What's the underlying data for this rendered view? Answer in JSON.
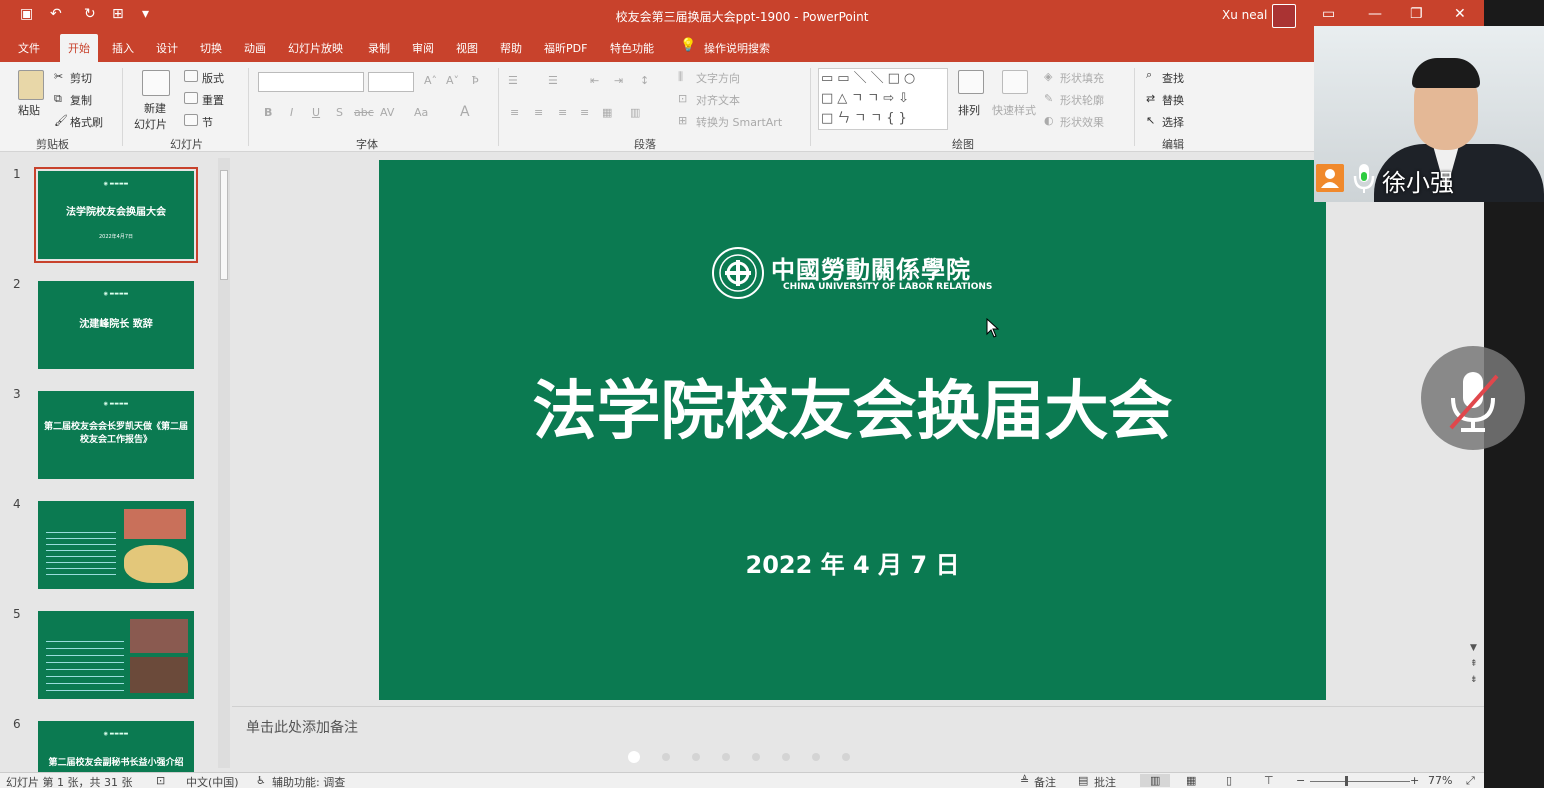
{
  "window": {
    "title": "校友会第三届换届大会ppt-1900 - PowerPoint",
    "user": "Xu neal"
  },
  "tabs": [
    "文件",
    "开始",
    "插入",
    "设计",
    "切换",
    "动画",
    "幻灯片放映",
    "录制",
    "审阅",
    "视图",
    "帮助",
    "福昕PDF",
    "特色功能",
    "操作说明搜索"
  ],
  "ribbon": {
    "clipboard": {
      "paste": "粘贴",
      "cut": "剪切",
      "copy": "复制",
      "format_painter": "格式刷",
      "label": "剪贴板"
    },
    "slides": {
      "new_slide": "新建",
      "new_slide2": "幻灯片",
      "layout": "版式",
      "reset": "重置",
      "section": "节",
      "label": "幻灯片"
    },
    "font": {
      "label": "字体"
    },
    "paragraph": {
      "text_direction": "文字方向",
      "align_text": "对齐文本",
      "smartart": "转换为 SmartArt",
      "label": "段落"
    },
    "drawing": {
      "arrange": "排列",
      "quick_styles": "快速样式",
      "shape_fill": "形状填充",
      "shape_outline": "形状轮廓",
      "shape_effects": "形状效果",
      "label": "绘图"
    },
    "editing": {
      "find": "查找",
      "replace": "替换",
      "select": "选择",
      "label": "编辑"
    }
  },
  "thumbnails": [
    {
      "num": "1",
      "title": "法学院校友会换届大会",
      "date": "2022年4月7日"
    },
    {
      "num": "2",
      "title": "沈建峰院长 致辞"
    },
    {
      "num": "3",
      "title": "第二届校友会会长罗凯天做《第二届校友会工作报告》"
    },
    {
      "num": "4",
      "title": ""
    },
    {
      "num": "5",
      "title": ""
    },
    {
      "num": "6",
      "title": "第二届校友会副秘书长益小强介绍"
    }
  ],
  "slide": {
    "logo_cn": "中國勞動關係學院",
    "logo_en": "CHINA UNIVERSITY OF LABOR RELATIONS",
    "title": "法学院校友会换届大会",
    "date": "2022 年 4 月 7 日"
  },
  "notes": {
    "placeholder": "单击此处添加备注"
  },
  "status": {
    "slide_count": "幻灯片 第 1 张，共 31 张",
    "language": "中文(中国)",
    "accessibility": "辅助功能: 调查",
    "notes": "备注",
    "comments": "批注",
    "zoom": "77%"
  },
  "meeting": {
    "participant_name": "徐小强"
  },
  "colors": {
    "ribbon_red": "#c8422c",
    "slide_green": "#0b7a51",
    "badge_orange": "#f0892c"
  }
}
